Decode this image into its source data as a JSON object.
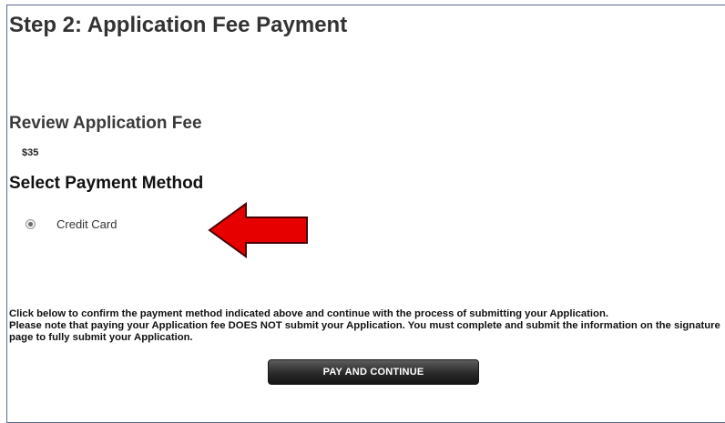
{
  "page": {
    "step_title": "Step 2: Application Fee Payment"
  },
  "review": {
    "title": "Review Application Fee",
    "amount": "$35"
  },
  "payment": {
    "title": "Select Payment Method",
    "options": [
      {
        "label": "Credit Card",
        "selected": true
      }
    ]
  },
  "annotation": {
    "icon": "arrow-left-icon",
    "color": "#e60000"
  },
  "notice": {
    "line1": "Click below to confirm the payment method indicated above and continue with the process of submitting your Application.",
    "line2": "Please note that paying your Application fee DOES NOT submit your Application. You must complete and submit the information on the signature page to fully submit your Application."
  },
  "actions": {
    "pay_label": "PAY AND CONTINUE"
  }
}
